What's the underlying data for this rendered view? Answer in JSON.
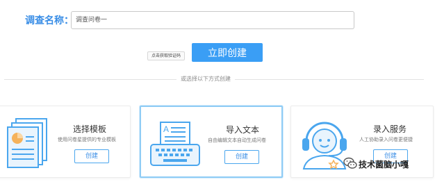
{
  "form": {
    "name_label": "调查名称：",
    "name_value": "调查问卷一",
    "captcha_label": "点击获取验证码",
    "create_button": "立即创建"
  },
  "divider": {
    "text": "或选择以下方式创建"
  },
  "cards": [
    {
      "title": "选择模板",
      "desc": "使用问卷星提供的专业模板",
      "button": "创建",
      "icon": "document-template-icon"
    },
    {
      "title": "导入文本",
      "desc": "自由编辑文本自动生成问卷",
      "button": "创建",
      "icon": "typewriter-icon"
    },
    {
      "title": "录入服务",
      "desc": "人工协助录入问卷更便捷",
      "button": "创建",
      "icon": "customer-service-icon"
    }
  ],
  "watermark": {
    "text": "技术菌脑小嘎",
    "icon": "wechat-logo"
  },
  "colors": {
    "accent": "#3a9ef5",
    "label_blue": "#3a8ee6",
    "icon_blue": "#4aa6ee"
  }
}
